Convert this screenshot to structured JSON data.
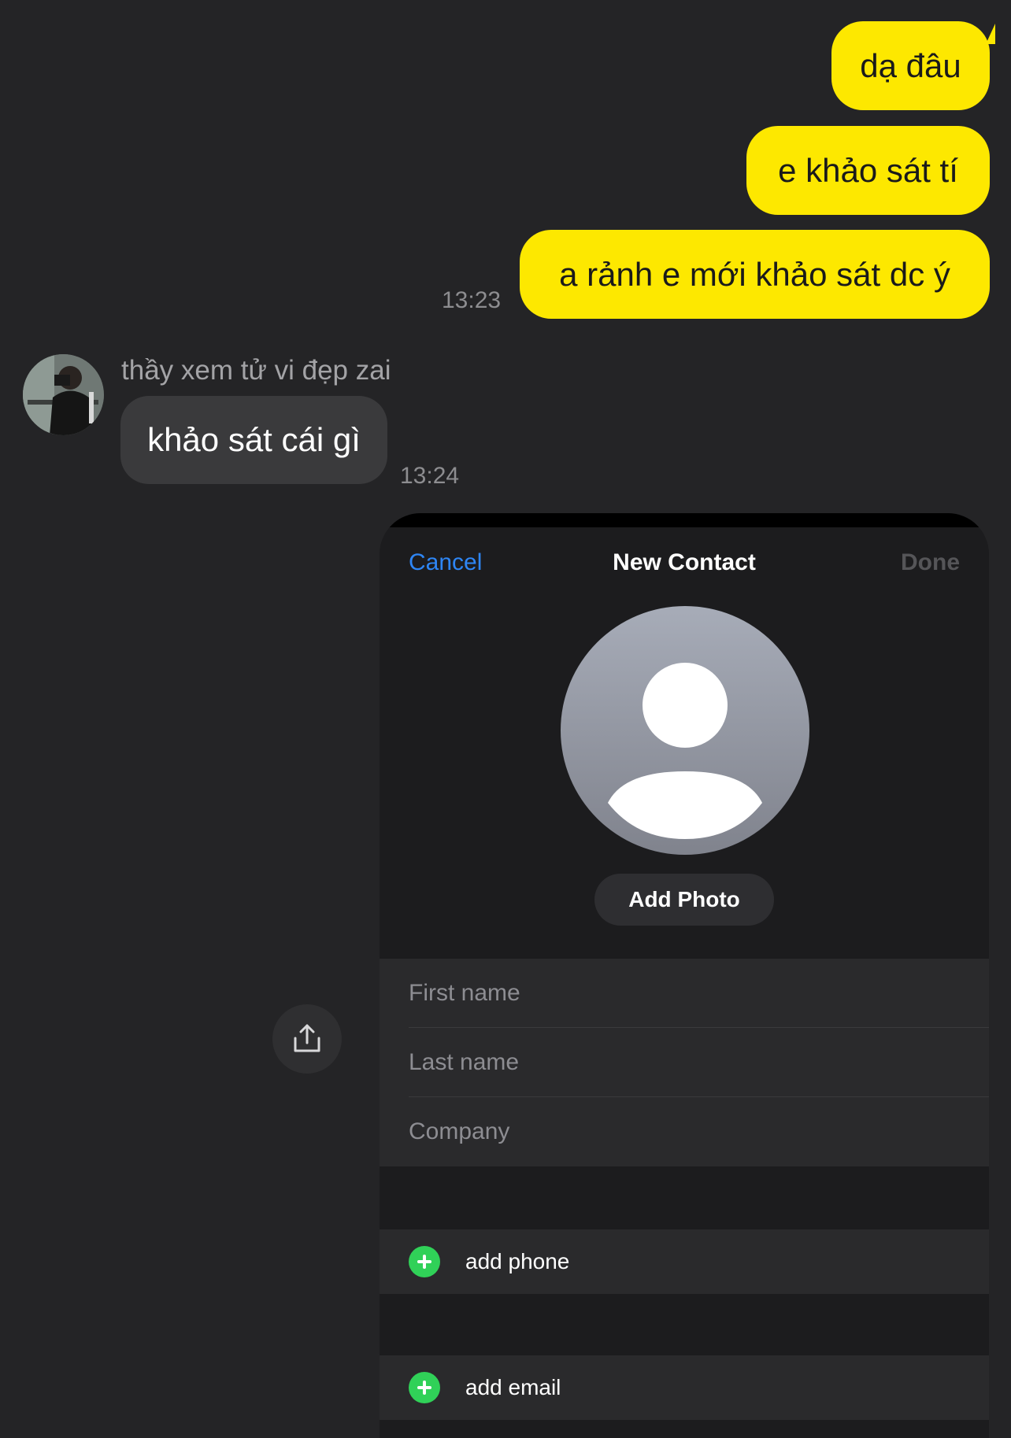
{
  "chat": {
    "outgoing": [
      {
        "text": "dạ đâu"
      },
      {
        "text": "e khảo sát tí"
      },
      {
        "text": "a rảnh e mới khảo sát dc ý"
      }
    ],
    "outgoing_time": "13:23",
    "incoming": {
      "sender": "thầy xem tử vi đẹp zai",
      "text": "khảo sát cái gì",
      "time": "13:24"
    }
  },
  "contact_card": {
    "cancel_label": "Cancel",
    "title": "New Contact",
    "done_label": "Done",
    "add_photo_label": "Add Photo",
    "fields": {
      "first_name_placeholder": "First name",
      "last_name_placeholder": "Last name",
      "company_placeholder": "Company"
    },
    "add_phone_label": "add phone",
    "add_email_label": "add email"
  },
  "icons": {
    "share": "share-icon",
    "add": "plus-circle-icon",
    "avatar_placeholder": "person-silhouette-icon"
  },
  "colors": {
    "background": "#242426",
    "outgoing_bubble": "#fde800",
    "incoming_bubble": "#3a3a3c",
    "link_blue": "#2e86f5",
    "add_green": "#30d158"
  }
}
